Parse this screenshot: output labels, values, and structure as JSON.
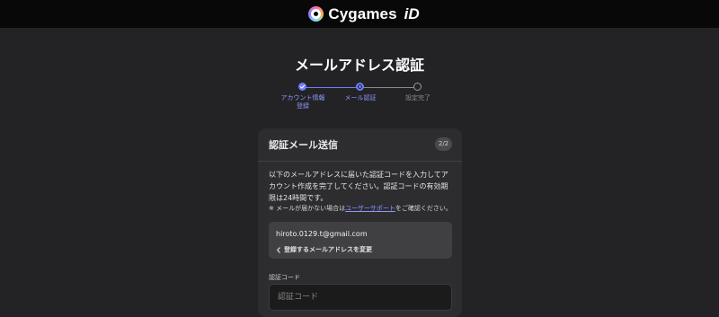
{
  "header": {
    "brand_name": "Cygames",
    "brand_suffix": "iD",
    "logo_icon": "cygames-id-logo-icon"
  },
  "page": {
    "title": "メールアドレス認証"
  },
  "steps": {
    "items": [
      {
        "label": "アカウント情報\n登録",
        "state": "completed"
      },
      {
        "label": "メール認証",
        "state": "current"
      },
      {
        "label": "設定完了",
        "state": "upcoming"
      }
    ],
    "active_color": "#6f7dff",
    "inactive_color": "#8a8a8a"
  },
  "card": {
    "title": "認証メール送信",
    "badge": "2/2",
    "description": "以下のメールアドレスに届いた認証コードを入力してアカウント作成を完了してください。認証コードの有効期限は24時間です。",
    "note_prefix": "※ メールが届かない場合は",
    "note_link": "ユーザーサポート",
    "note_suffix": "をご確認ください。",
    "email": "hiroto.0129.t@gmail.com",
    "change_email_label": "登録するメールアドレスを変更",
    "code_field_label": "認証コード",
    "code_placeholder": "認証コード",
    "code_value": ""
  },
  "colors": {
    "background": "#232325",
    "topbar": "#080808",
    "card": "#2d2d2f",
    "accent": "#6f7dff"
  }
}
